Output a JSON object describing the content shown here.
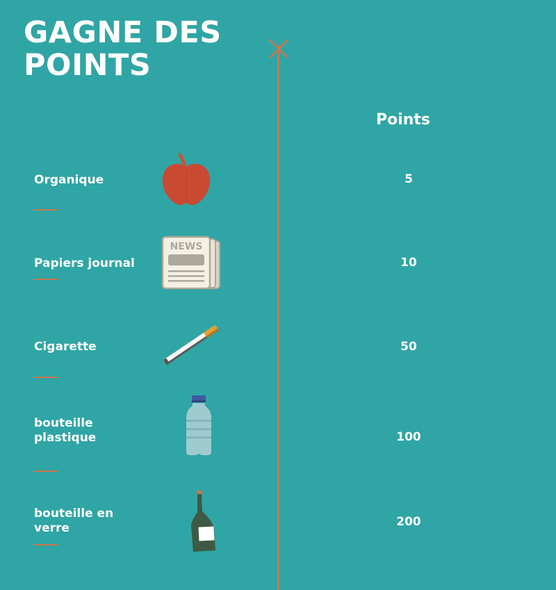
{
  "title": "GAGNE DES POINTS",
  "column_header": "Points",
  "colors": {
    "background": "#30a5a5",
    "accent": "#c8774f",
    "text": "#ffffff"
  },
  "items": [
    {
      "label": "Organique",
      "points": "5",
      "icon": "apple-icon"
    },
    {
      "label": "Papiers journal",
      "points": "10",
      "icon": "newspaper-icon",
      "icon_text": "NEWS"
    },
    {
      "label": "Cigarette",
      "points": "50",
      "icon": "cigarette-icon"
    },
    {
      "label": "bouteille plastique",
      "points": "100",
      "icon": "plastic-bottle-icon"
    },
    {
      "label": "bouteille en verre",
      "points": "200",
      "icon": "glass-bottle-icon"
    }
  ]
}
